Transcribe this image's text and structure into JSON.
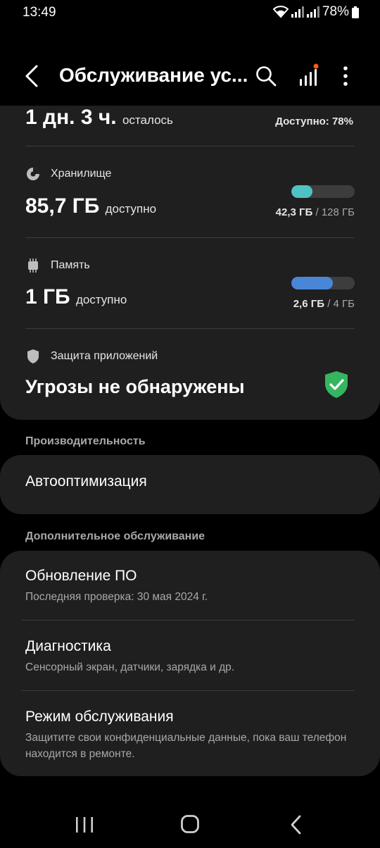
{
  "status": {
    "time": "13:49",
    "battery_percent": "78%"
  },
  "app_bar": {
    "title": "Обслуживание ус..."
  },
  "battery": {
    "remaining": "1 дн. 3 ч.",
    "remaining_suffix": "осталось",
    "available": "Доступно: 78%"
  },
  "storage": {
    "label": "Хранилище",
    "value": "85,7 ГБ",
    "value_suffix": "доступно",
    "used": "42,3 ГБ",
    "total": "/ 128 ГБ",
    "fraction_used": 0.33,
    "bar_color": "#4fc3c3"
  },
  "memory": {
    "label": "Память",
    "value": "1 ГБ",
    "value_suffix": "доступно",
    "used": "2,6 ГБ",
    "total": "/ 4 ГБ",
    "fraction_used": 0.65,
    "bar_color": "#4a86d8"
  },
  "app_protection": {
    "label": "Защита приложений",
    "status": "Угрозы не обнаружены",
    "status_color": "#35b560"
  },
  "performance": {
    "header": "Производительность",
    "auto_optimization": "Автооптимизация"
  },
  "additional": {
    "header": "Дополнительное обслуживание",
    "items": [
      {
        "title": "Обновление ПО",
        "subtitle": "Последняя проверка: 30 мая 2024 г."
      },
      {
        "title": "Диагностика",
        "subtitle": "Сенсорный экран, датчики, зарядка и др."
      },
      {
        "title": "Режим обслуживания",
        "subtitle": "Защитите свои конфиденциальные данные, пока ваш телефон находится в ремонте."
      }
    ]
  },
  "icons": {
    "back": "back-arrow-icon",
    "search": "search-icon",
    "stats": "bar-chart-icon",
    "more": "more-vertical-icon",
    "storage": "pie-chart-icon",
    "memory": "chip-icon",
    "protection": "shield-icon",
    "ok": "shield-check-icon"
  }
}
